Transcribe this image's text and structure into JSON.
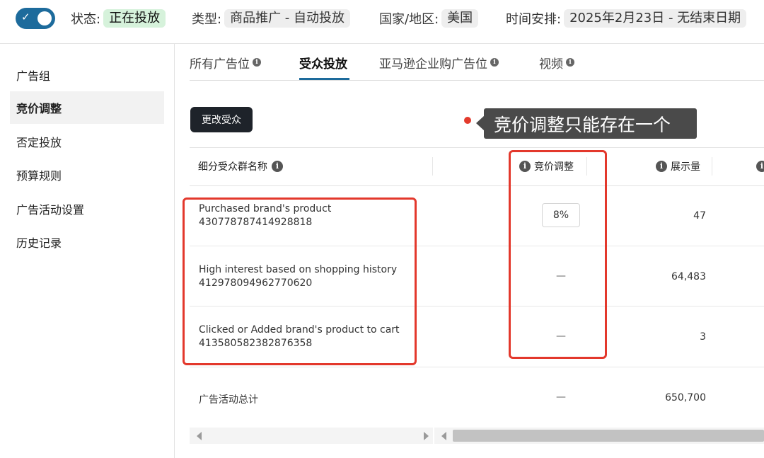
{
  "header": {
    "status_label": "状态:",
    "status_value": "正在投放",
    "type_label": "类型:",
    "type_value": "商品推广 - 自动投放",
    "country_label": "国家/地区:",
    "country_value": "美国",
    "schedule_label": "时间安排:",
    "schedule_value": "2025年2月23日 - 无结束日期",
    "toggle_check": "✓"
  },
  "sidebar": {
    "items": [
      {
        "label": "广告组"
      },
      {
        "label": "竞价调整"
      },
      {
        "label": "否定投放"
      },
      {
        "label": "预算规则"
      },
      {
        "label": "广告活动设置"
      },
      {
        "label": "历史记录"
      }
    ]
  },
  "tabs": [
    {
      "label": "所有广告位"
    },
    {
      "label": "受众投放"
    },
    {
      "label": "亚马逊企业购广告位"
    },
    {
      "label": "视频"
    }
  ],
  "info_glyph": "i",
  "change_audience_button": "更改受众",
  "annotation": "竞价调整只能存在一个",
  "table": {
    "headers": {
      "segment": "细分受众群名称",
      "bid_adjust": "竞价调整",
      "impressions": "展示量"
    },
    "rows": [
      {
        "name": "Purchased brand's product",
        "id": "430778787414928818",
        "bid": "8%",
        "impressions": "47"
      },
      {
        "name": "High interest based on shopping history",
        "id": "412978094962770620",
        "bid": "—",
        "impressions": "64,483"
      },
      {
        "name": "Clicked or Added brand's product to cart",
        "id": "413580582382876358",
        "bid": "—",
        "impressions": "3"
      }
    ],
    "total": {
      "label": "广告活动总计",
      "bid": "—",
      "impressions": "650,700"
    }
  },
  "colors": {
    "accent": "#1d6b9c",
    "status_green_bg": "#d6f2db",
    "highlight_red": "#e3382c",
    "callout_bg": "#4a4a4a",
    "button_dark": "#1e232a"
  }
}
